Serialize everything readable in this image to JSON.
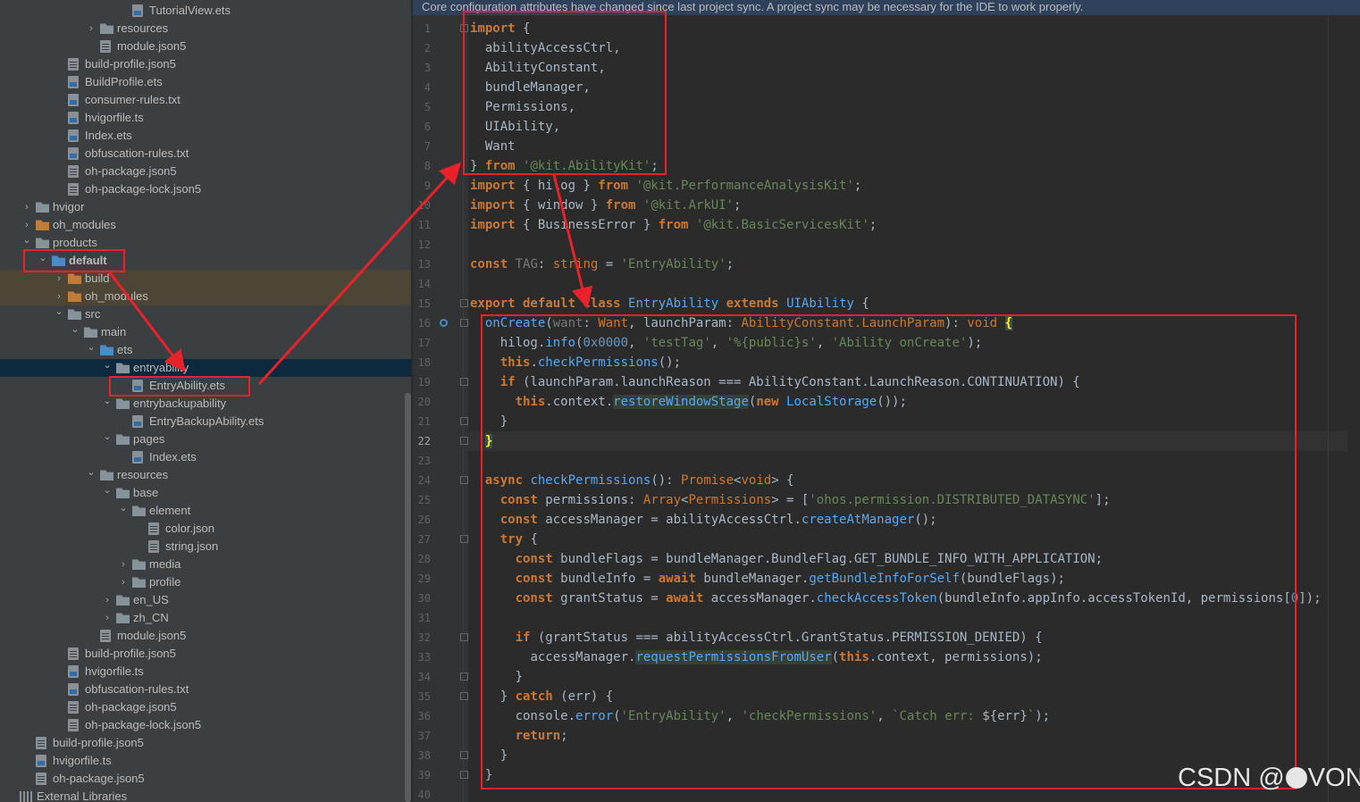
{
  "notice": "Core configuration attributes have changed since last project sync. A project sync may be necessary for the IDE to work properly.",
  "tree": {
    "items": [
      {
        "label": "TutorialView.ets",
        "depth": 7,
        "kind": "file",
        "chevron": ""
      },
      {
        "label": "resources",
        "depth": 5,
        "kind": "folder",
        "chevron": "right"
      },
      {
        "label": "module.json5",
        "depth": 5,
        "kind": "json",
        "chevron": ""
      },
      {
        "label": "build-profile.json5",
        "depth": 3,
        "kind": "json",
        "chevron": ""
      },
      {
        "label": "BuildProfile.ets",
        "depth": 3,
        "kind": "file",
        "chevron": ""
      },
      {
        "label": "consumer-rules.txt",
        "depth": 3,
        "kind": "file",
        "chevron": ""
      },
      {
        "label": "hvigorfile.ts",
        "depth": 3,
        "kind": "file",
        "chevron": ""
      },
      {
        "label": "Index.ets",
        "depth": 3,
        "kind": "file",
        "chevron": ""
      },
      {
        "label": "obfuscation-rules.txt",
        "depth": 3,
        "kind": "file",
        "chevron": ""
      },
      {
        "label": "oh-package.json5",
        "depth": 3,
        "kind": "json",
        "chevron": ""
      },
      {
        "label": "oh-package-lock.json5",
        "depth": 3,
        "kind": "json",
        "chevron": ""
      },
      {
        "label": "hvigor",
        "depth": 1,
        "kind": "folder",
        "chevron": "right"
      },
      {
        "label": "oh_modules",
        "depth": 1,
        "kind": "folder-orange",
        "chevron": "right"
      },
      {
        "label": "products",
        "depth": 1,
        "kind": "folder",
        "chevron": "down"
      },
      {
        "label": "default",
        "depth": 2,
        "kind": "folder-blue",
        "chevron": "down",
        "bold": true
      },
      {
        "label": "build",
        "depth": 3,
        "kind": "folder-orange",
        "chevron": "right",
        "mark": true
      },
      {
        "label": "oh_modules",
        "depth": 3,
        "kind": "folder-orange",
        "chevron": "right",
        "mark": true
      },
      {
        "label": "src",
        "depth": 3,
        "kind": "folder",
        "chevron": "down"
      },
      {
        "label": "main",
        "depth": 4,
        "kind": "folder",
        "chevron": "down"
      },
      {
        "label": "ets",
        "depth": 5,
        "kind": "folder-blue",
        "chevron": "down"
      },
      {
        "label": "entryability",
        "depth": 6,
        "kind": "folder",
        "chevron": "down",
        "selected": true
      },
      {
        "label": "EntryAbility.ets",
        "depth": 7,
        "kind": "file",
        "chevron": ""
      },
      {
        "label": "entrybackupability",
        "depth": 6,
        "kind": "folder",
        "chevron": "down"
      },
      {
        "label": "EntryBackupAbility.ets",
        "depth": 7,
        "kind": "file",
        "chevron": ""
      },
      {
        "label": "pages",
        "depth": 6,
        "kind": "folder",
        "chevron": "down"
      },
      {
        "label": "Index.ets",
        "depth": 7,
        "kind": "file",
        "chevron": ""
      },
      {
        "label": "resources",
        "depth": 5,
        "kind": "folder",
        "chevron": "down"
      },
      {
        "label": "base",
        "depth": 6,
        "kind": "folder",
        "chevron": "down"
      },
      {
        "label": "element",
        "depth": 7,
        "kind": "folder",
        "chevron": "down"
      },
      {
        "label": "color.json",
        "depth": 8,
        "kind": "json",
        "chevron": ""
      },
      {
        "label": "string.json",
        "depth": 8,
        "kind": "json",
        "chevron": ""
      },
      {
        "label": "media",
        "depth": 7,
        "kind": "folder",
        "chevron": "right"
      },
      {
        "label": "profile",
        "depth": 7,
        "kind": "folder",
        "chevron": "right"
      },
      {
        "label": "en_US",
        "depth": 6,
        "kind": "folder",
        "chevron": "right"
      },
      {
        "label": "zh_CN",
        "depth": 6,
        "kind": "folder",
        "chevron": "right"
      },
      {
        "label": "module.json5",
        "depth": 5,
        "kind": "json",
        "chevron": ""
      },
      {
        "label": "build-profile.json5",
        "depth": 3,
        "kind": "json",
        "chevron": ""
      },
      {
        "label": "hvigorfile.ts",
        "depth": 3,
        "kind": "file",
        "chevron": ""
      },
      {
        "label": "obfuscation-rules.txt",
        "depth": 3,
        "kind": "file",
        "chevron": ""
      },
      {
        "label": "oh-package.json5",
        "depth": 3,
        "kind": "json",
        "chevron": ""
      },
      {
        "label": "oh-package-lock.json5",
        "depth": 3,
        "kind": "json",
        "chevron": ""
      },
      {
        "label": "build-profile.json5",
        "depth": 1,
        "kind": "json",
        "chevron": ""
      },
      {
        "label": "hvigorfile.ts",
        "depth": 1,
        "kind": "file",
        "chevron": ""
      },
      {
        "label": "oh-package.json5",
        "depth": 1,
        "kind": "json",
        "chevron": ""
      },
      {
        "label": "External Libraries",
        "depth": 0,
        "kind": "lib",
        "chevron": ""
      }
    ]
  },
  "editor": {
    "current_line": 22,
    "lines": [
      {
        "n": 1,
        "indent": 0,
        "fold": true,
        "tokens": [
          [
            "kw",
            "import"
          ],
          [
            "p",
            " {"
          ]
        ]
      },
      {
        "n": 2,
        "indent": 1,
        "tokens": [
          [
            "p",
            "abilityAccessCtrl,"
          ]
        ]
      },
      {
        "n": 3,
        "indent": 1,
        "tokens": [
          [
            "p",
            "AbilityConstant,"
          ]
        ]
      },
      {
        "n": 4,
        "indent": 1,
        "tokens": [
          [
            "p",
            "bundleManager,"
          ]
        ]
      },
      {
        "n": 5,
        "indent": 1,
        "tokens": [
          [
            "p",
            "Permissions,"
          ]
        ]
      },
      {
        "n": 6,
        "indent": 1,
        "tokens": [
          [
            "p",
            "UIAbility,"
          ]
        ]
      },
      {
        "n": 7,
        "indent": 1,
        "tokens": [
          [
            "p",
            "Want"
          ]
        ]
      },
      {
        "n": 8,
        "indent": 0,
        "tokens": [
          [
            "p",
            "} "
          ],
          [
            "kw",
            "from"
          ],
          [
            "p",
            " "
          ],
          [
            "str",
            "'@kit.AbilityKit'"
          ],
          [
            "p",
            ";"
          ]
        ]
      },
      {
        "n": 9,
        "indent": 0,
        "tokens": [
          [
            "kw",
            "import"
          ],
          [
            "p",
            " { hilog } "
          ],
          [
            "kw",
            "from"
          ],
          [
            "p",
            " "
          ],
          [
            "str",
            "'@kit.PerformanceAnalysisKit'"
          ],
          [
            "p",
            ";"
          ]
        ]
      },
      {
        "n": 10,
        "indent": 0,
        "tokens": [
          [
            "kw",
            "import"
          ],
          [
            "p",
            " { window } "
          ],
          [
            "kw",
            "from"
          ],
          [
            "p",
            " "
          ],
          [
            "str",
            "'@kit.ArkUI'"
          ],
          [
            "p",
            ";"
          ]
        ]
      },
      {
        "n": 11,
        "indent": 0,
        "tokens": [
          [
            "kw",
            "import"
          ],
          [
            "p",
            " { BusinessError } "
          ],
          [
            "kw",
            "from"
          ],
          [
            "p",
            " "
          ],
          [
            "str",
            "'@kit.BasicServicesKit'"
          ],
          [
            "p",
            ";"
          ]
        ]
      },
      {
        "n": 12,
        "indent": 0,
        "tokens": []
      },
      {
        "n": 13,
        "indent": 0,
        "tokens": [
          [
            "kw",
            "const"
          ],
          [
            "p",
            " "
          ],
          [
            "dim",
            "TAG"
          ],
          [
            "p",
            ": "
          ],
          [
            "type",
            "string"
          ],
          [
            "p",
            " = "
          ],
          [
            "str",
            "'EntryAbility'"
          ],
          [
            "p",
            ";"
          ]
        ]
      },
      {
        "n": 14,
        "indent": 0,
        "tokens": []
      },
      {
        "n": 15,
        "indent": 0,
        "fold": true,
        "tokens": [
          [
            "kw",
            "export default class"
          ],
          [
            "p",
            " "
          ],
          [
            "cls",
            "EntryAbility"
          ],
          [
            "p",
            " "
          ],
          [
            "kw",
            "extends"
          ],
          [
            "p",
            " "
          ],
          [
            "cls",
            "UIAbility"
          ],
          [
            "p",
            " {"
          ]
        ]
      },
      {
        "n": 16,
        "indent": 1,
        "fold": true,
        "bookmark": true,
        "tokens": [
          [
            "fn",
            "onCreate"
          ],
          [
            "p",
            "("
          ],
          [
            "dim",
            "want"
          ],
          [
            "p",
            ": "
          ],
          [
            "type",
            "Want"
          ],
          [
            "p",
            ", launchParam: "
          ],
          [
            "type",
            "AbilityConstant.LaunchParam"
          ],
          [
            "p",
            "): "
          ],
          [
            "type",
            "void"
          ],
          [
            "p",
            " "
          ],
          [
            "brace",
            "{"
          ]
        ]
      },
      {
        "n": 17,
        "indent": 2,
        "tokens": [
          [
            "p",
            "hilog."
          ],
          [
            "fn",
            "info"
          ],
          [
            "p",
            "("
          ],
          [
            "num",
            "0x0000"
          ],
          [
            "p",
            ", "
          ],
          [
            "str",
            "'testTag'"
          ],
          [
            "p",
            ", "
          ],
          [
            "str",
            "'%{public}s'"
          ],
          [
            "p",
            ", "
          ],
          [
            "str",
            "'Ability onCreate'"
          ],
          [
            "p",
            ");"
          ]
        ]
      },
      {
        "n": 18,
        "indent": 2,
        "tokens": [
          [
            "kw",
            "this"
          ],
          [
            "p",
            "."
          ],
          [
            "fn",
            "checkPermissions"
          ],
          [
            "p",
            "();"
          ]
        ]
      },
      {
        "n": 19,
        "indent": 2,
        "fold": true,
        "tokens": [
          [
            "kw",
            "if"
          ],
          [
            "p",
            " (launchParam.launchReason === AbilityConstant.LaunchReason.CONTINUATION) {"
          ]
        ]
      },
      {
        "n": 20,
        "indent": 3,
        "tokens": [
          [
            "kw",
            "this"
          ],
          [
            "p",
            ".context."
          ],
          [
            "hl",
            "restoreWindowStage"
          ],
          [
            "p",
            "("
          ],
          [
            "kw",
            "new"
          ],
          [
            "p",
            " "
          ],
          [
            "cls",
            "LocalStorage"
          ],
          [
            "p",
            "());"
          ]
        ]
      },
      {
        "n": 21,
        "indent": 2,
        "fold": true,
        "tokens": [
          [
            "p",
            "}"
          ]
        ]
      },
      {
        "n": 22,
        "indent": 1,
        "fold": true,
        "tokens": [
          [
            "brace",
            "}"
          ]
        ]
      },
      {
        "n": 23,
        "indent": 0,
        "tokens": []
      },
      {
        "n": 24,
        "indent": 1,
        "fold": true,
        "tokens": [
          [
            "kw",
            "async"
          ],
          [
            "p",
            " "
          ],
          [
            "fn",
            "checkPermissions"
          ],
          [
            "p",
            "(): "
          ],
          [
            "type",
            "Promise"
          ],
          [
            "p",
            "<"
          ],
          [
            "type",
            "void"
          ],
          [
            "p",
            "> {"
          ]
        ]
      },
      {
        "n": 25,
        "indent": 2,
        "tokens": [
          [
            "kw",
            "const"
          ],
          [
            "p",
            " permissions: "
          ],
          [
            "type",
            "Array"
          ],
          [
            "p",
            "<"
          ],
          [
            "type",
            "Permissions"
          ],
          [
            "p",
            "> = ["
          ],
          [
            "str",
            "'ohos.permission.DISTRIBUTED_DATASYNC'"
          ],
          [
            "p",
            "];"
          ]
        ]
      },
      {
        "n": 26,
        "indent": 2,
        "tokens": [
          [
            "kw",
            "const"
          ],
          [
            "p",
            " accessManager = abilityAccessCtrl."
          ],
          [
            "fn",
            "createAtManager"
          ],
          [
            "p",
            "();"
          ]
        ]
      },
      {
        "n": 27,
        "indent": 2,
        "fold": true,
        "tokens": [
          [
            "kw",
            "try"
          ],
          [
            "p",
            " {"
          ]
        ]
      },
      {
        "n": 28,
        "indent": 3,
        "tokens": [
          [
            "kw",
            "const"
          ],
          [
            "p",
            " bundleFlags = bundleManager.BundleFlag.GET_BUNDLE_INFO_WITH_APPLICATION;"
          ]
        ]
      },
      {
        "n": 29,
        "indent": 3,
        "tokens": [
          [
            "kw",
            "const"
          ],
          [
            "p",
            " bundleInfo = "
          ],
          [
            "kw",
            "await"
          ],
          [
            "p",
            " bundleManager."
          ],
          [
            "fn",
            "getBundleInfoForSelf"
          ],
          [
            "p",
            "(bundleFlags);"
          ]
        ]
      },
      {
        "n": 30,
        "indent": 3,
        "tokens": [
          [
            "kw",
            "const"
          ],
          [
            "p",
            " grantStatus = "
          ],
          [
            "kw",
            "await"
          ],
          [
            "p",
            " accessManager."
          ],
          [
            "fn",
            "checkAccessToken"
          ],
          [
            "p",
            "(bundleInfo.appInfo.accessTokenId, permissions["
          ],
          [
            "num",
            "0"
          ],
          [
            "p",
            "]);"
          ]
        ]
      },
      {
        "n": 31,
        "indent": 0,
        "tokens": []
      },
      {
        "n": 32,
        "indent": 3,
        "fold": true,
        "tokens": [
          [
            "kw",
            "if"
          ],
          [
            "p",
            " (grantStatus === abilityAccessCtrl.GrantStatus.PERMISSION_DENIED) {"
          ]
        ]
      },
      {
        "n": 33,
        "indent": 4,
        "tokens": [
          [
            "p",
            "accessManager."
          ],
          [
            "hl",
            "requestPermissionsFromUser"
          ],
          [
            "p",
            "("
          ],
          [
            "kw",
            "this"
          ],
          [
            "p",
            ".context, permissions);"
          ]
        ]
      },
      {
        "n": 34,
        "indent": 3,
        "fold": true,
        "tokens": [
          [
            "p",
            "}"
          ]
        ]
      },
      {
        "n": 35,
        "indent": 2,
        "fold": true,
        "tokens": [
          [
            "p",
            "} "
          ],
          [
            "kw",
            "catch"
          ],
          [
            "p",
            " (err) {"
          ]
        ]
      },
      {
        "n": 36,
        "indent": 3,
        "tokens": [
          [
            "p",
            "console."
          ],
          [
            "fn",
            "error"
          ],
          [
            "p",
            "("
          ],
          [
            "str",
            "'EntryAbility'"
          ],
          [
            "p",
            ", "
          ],
          [
            "str",
            "'checkPermissions'"
          ],
          [
            "p",
            ", "
          ],
          [
            "str",
            "`Catch err: "
          ],
          [
            "p",
            "${err}"
          ],
          [
            "str",
            "`"
          ],
          [
            "p",
            ");"
          ]
        ]
      },
      {
        "n": 37,
        "indent": 3,
        "tokens": [
          [
            "kw",
            "return"
          ],
          [
            "p",
            ";"
          ]
        ]
      },
      {
        "n": 38,
        "indent": 2,
        "fold": true,
        "tokens": [
          [
            "p",
            "}"
          ]
        ]
      },
      {
        "n": 39,
        "indent": 1,
        "fold": true,
        "tokens": [
          [
            "p",
            "}"
          ]
        ]
      },
      {
        "n": 40,
        "indent": 0,
        "tokens": []
      }
    ]
  },
  "colors": {
    "kw": "#cc7832",
    "str": "#6a8759",
    "fn": "#56a8f5",
    "type": "#cc7832",
    "cls": "#56a8f5",
    "num": "#6897bb",
    "dim": "#787878",
    "p": "#a9b7c6",
    "annotation": "#e8222a"
  },
  "icons": {
    "chevron_right": "›",
    "chevron_down": "⌄",
    "bookmark": "bookmark-icon"
  },
  "watermark": {
    "prefix": "CSDN @",
    "suffix": "VON"
  }
}
